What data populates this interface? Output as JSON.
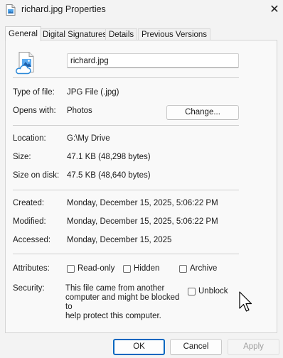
{
  "window": {
    "title": "richard.jpg Properties",
    "close_symbol": "✕"
  },
  "tabs": [
    {
      "label": "General",
      "active": true
    },
    {
      "label": "Digital Signatures",
      "active": false
    },
    {
      "label": "Details",
      "active": false
    },
    {
      "label": "Previous Versions",
      "active": false
    }
  ],
  "general": {
    "filename": "richard.jpg",
    "type_label": "Type of file:",
    "type_value": "JPG File (.jpg)",
    "opens_label": "Opens with:",
    "opens_value": "Photos",
    "change_button": "Change...",
    "location_label": "Location:",
    "location_value": "G:\\My Drive",
    "size_label": "Size:",
    "size_value": "47.1 KB (48,298 bytes)",
    "size_on_disk_label": "Size on disk:",
    "size_on_disk_value": "47.5 KB (48,640 bytes)",
    "created_label": "Created:",
    "created_value": "Monday, December 15, 2025, 5:06:22 PM",
    "modified_label": "Modified:",
    "modified_value": "Monday, December 15, 2025, 5:06:22 PM",
    "accessed_label": "Accessed:",
    "accessed_value": "Monday, December 15, 2025",
    "attributes_label": "Attributes:",
    "readonly_label": "Read-only",
    "readonly_checked": false,
    "hidden_label": "Hidden",
    "hidden_checked": false,
    "archive_label": "Archive",
    "archive_checked": false,
    "security_label": "Security:",
    "security_line1": "This file came from another",
    "security_line2": "computer and might be blocked to",
    "security_line3": "help protect this computer.",
    "unblock_label": "Unblock",
    "unblock_checked": false
  },
  "footer": {
    "ok_label": "OK",
    "cancel_label": "Cancel",
    "apply_label": "Apply",
    "apply_enabled": false
  },
  "colors": {
    "accent": "#0067c0",
    "cloud_icon": "#2e8ad8"
  },
  "icons": {
    "title": "image-file-icon",
    "file": "cloud-image-file-icon",
    "close": "close-icon",
    "cursor": "mouse-pointer-icon"
  }
}
